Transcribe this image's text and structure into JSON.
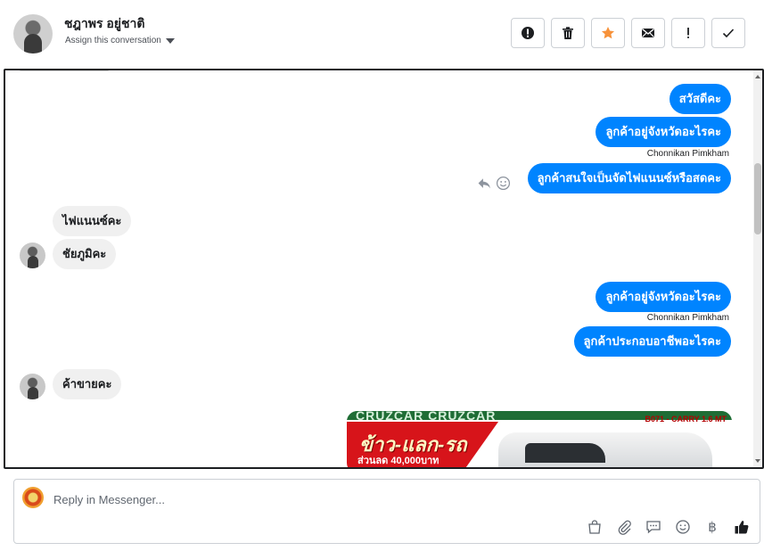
{
  "header": {
    "contact_name": "ชฎาพร อยู่ชาติ",
    "assign_label": "Assign this conversation",
    "actions": [
      {
        "icon": "alert-circle-icon"
      },
      {
        "icon": "trash-icon"
      },
      {
        "icon": "star-icon"
      },
      {
        "icon": "mail-icon"
      },
      {
        "icon": "exclamation-icon"
      },
      {
        "icon": "check-icon"
      }
    ]
  },
  "messages": {
    "m1": "สวัสดีคะ",
    "m2": "ลูกค้าอยู่จังหวัดอะไรคะ",
    "m2_sender": "Chonnikan Pimkham",
    "m3": "ลูกค้าสนใจเป็นจัดไฟแนนซ์หรือสดคะ",
    "m4": "ไฟแนนซ์คะ",
    "m5": "ชัยภูมิคะ",
    "m6": "ลูกค้าอยู่จังหวัดอะไรคะ",
    "m6_sender": "Chonnikan Pimkham",
    "m7": "ลูกค้าประกอบอาชีพอะไรคะ",
    "m8": "ค้าขายคะ"
  },
  "promo": {
    "title": "ข้าว-แลก-รถ",
    "subtitle": "ส่วนลด 40,000บาท",
    "tag": "B071 - CARRY 1.6 MT",
    "header_text": "CRUZCAR CRUZCAR"
  },
  "composer": {
    "placeholder": "Reply in Messenger...",
    "tools": [
      "bag-icon",
      "paperclip-icon",
      "speech-bubble-icon",
      "smiley-icon",
      "baht-icon",
      "thumbs-up-icon"
    ],
    "baht_symbol": "฿"
  },
  "colors": {
    "outgoing_bubble": "#0084ff",
    "incoming_bubble": "#f0f0f0",
    "star_accent": "#f7923a",
    "like_accent": "#1c1e21"
  }
}
